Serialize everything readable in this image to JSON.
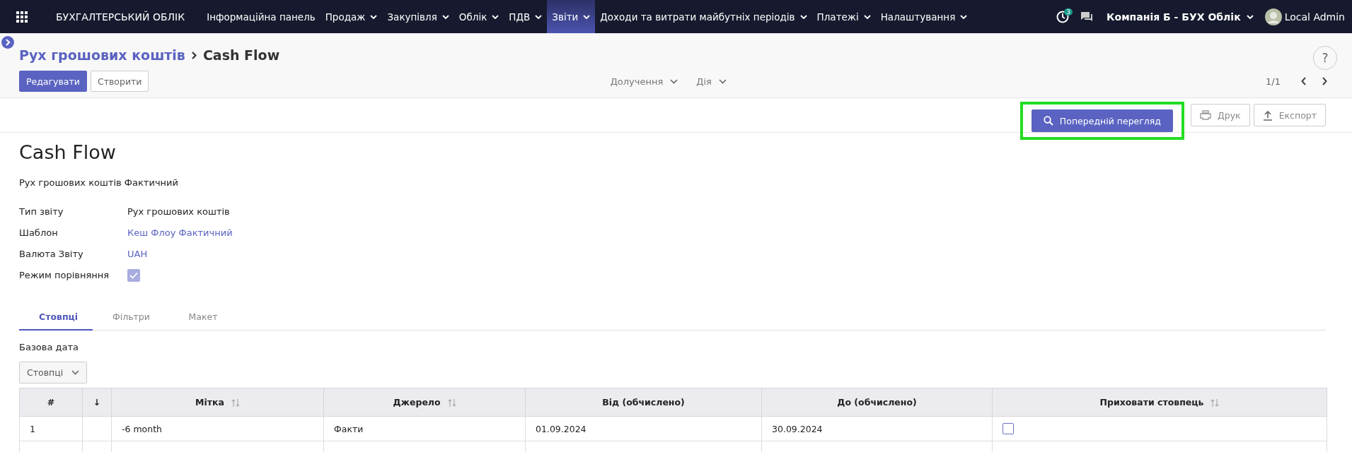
{
  "navbar": {
    "app_title": "БУХГАЛТЕРСЬКИЙ ОБЛІК",
    "menu": [
      {
        "label": "Інформаційна панель",
        "dropdown": false,
        "selected": false
      },
      {
        "label": "Продаж",
        "dropdown": true,
        "selected": false
      },
      {
        "label": "Закупівля",
        "dropdown": true,
        "selected": false
      },
      {
        "label": "Облік",
        "dropdown": true,
        "selected": false
      },
      {
        "label": "ПДВ",
        "dropdown": true,
        "selected": false
      },
      {
        "label": "Звіти",
        "dropdown": true,
        "selected": true
      },
      {
        "label": "Доходи та витрати майбутніх періодів",
        "dropdown": true,
        "selected": false
      },
      {
        "label": "Платежі",
        "dropdown": true,
        "selected": false
      },
      {
        "label": "Налаштування",
        "dropdown": true,
        "selected": false
      }
    ],
    "activity_badge": "3",
    "help": "?",
    "company": "Компанія Б - БУХ Облік",
    "user": "Local Admin"
  },
  "breadcrumb": {
    "parent": "Рух грошових коштів",
    "current": "Cash Flow"
  },
  "control_panel": {
    "buttons": [
      "Редагувати",
      "Створити"
    ],
    "dropdowns": [
      "Долучення",
      "Дія"
    ],
    "pager": "1/1"
  },
  "report_buttons": [
    {
      "label": "Попередній перегляд",
      "kind": "primary",
      "highlighted": true
    },
    {
      "label": "Друк",
      "kind": "print",
      "highlighted": false
    },
    {
      "label": "Експорт",
      "kind": "export",
      "highlighted": false
    }
  ],
  "form": {
    "title": "Cash Flow",
    "subtitle": "Рух грошових коштів Фактичний",
    "fields": [
      {
        "label": "Тип звіту",
        "kind": "text",
        "value": "Рух грошових коштів"
      },
      {
        "label": "Шаблон",
        "kind": "link",
        "value": "Кеш Флоу Фактичний"
      },
      {
        "label": "Валюта Звіту",
        "kind": "link",
        "value": "UAH"
      },
      {
        "label": "Режим порівняння",
        "kind": "checkbox",
        "checked": true
      }
    ]
  },
  "tabs": [
    {
      "label": "Стовпці",
      "selected": true
    },
    {
      "label": "Фільтри",
      "selected": false
    },
    {
      "label": "Макет",
      "selected": false
    }
  ],
  "base_date_label": "Базова дата",
  "columns_dropdown": "Стовпці",
  "table": {
    "columns": [
      {
        "label": "#",
        "sortable": false
      },
      {
        "label": "↓",
        "sortable": false
      },
      {
        "label": "Мітка",
        "sortable": true
      },
      {
        "label": "Джерело",
        "sortable": true
      },
      {
        "label": "Від (обчислено)",
        "sortable": false
      },
      {
        "label": "До (обчислено)",
        "sortable": false
      },
      {
        "label": "Приховати стовпець",
        "sortable": true
      }
    ],
    "rows": [
      {
        "cells": [
          "1",
          "",
          "-6 month",
          "Факти",
          "01.09.2024",
          "30.09.2024"
        ],
        "hidden": false
      }
    ]
  }
}
